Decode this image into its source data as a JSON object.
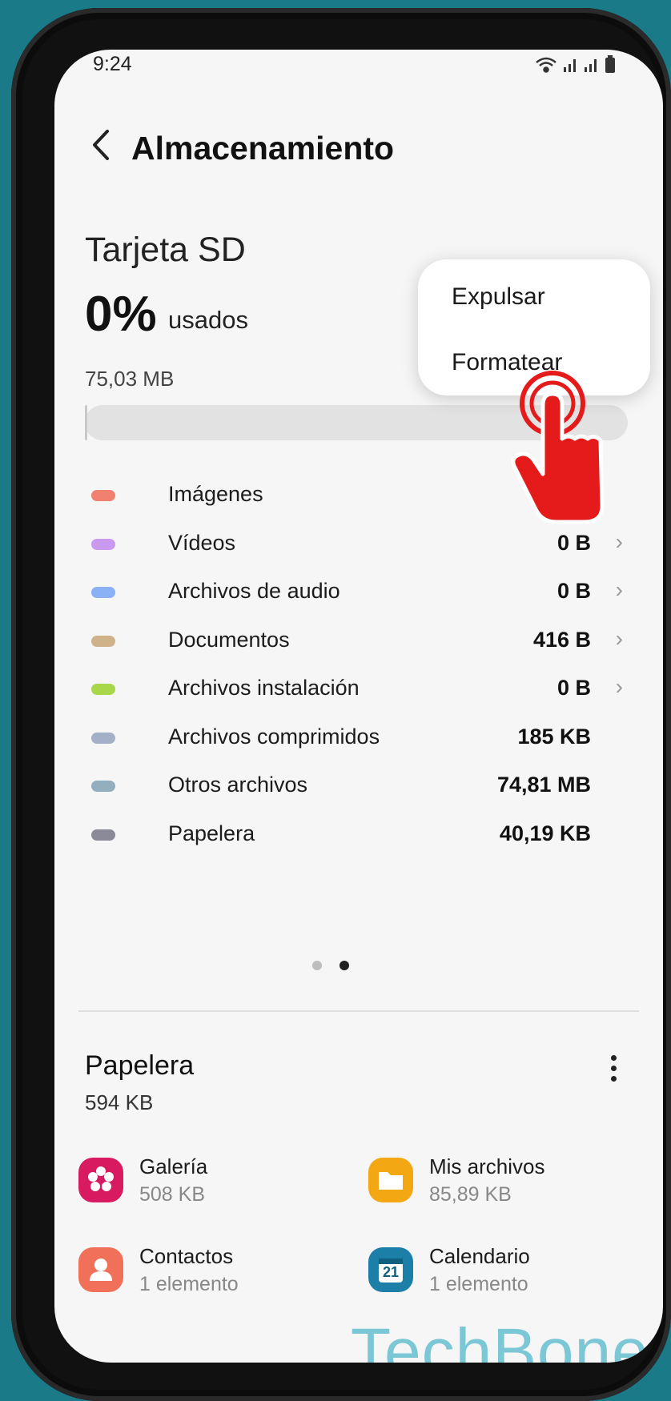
{
  "status_bar": {
    "time": "9:24",
    "icons": [
      "wifi-icon",
      "signal-icon",
      "signal-icon",
      "battery-icon"
    ]
  },
  "header": {
    "title": "Almacenamiento"
  },
  "storage": {
    "device": "Tarjeta SD",
    "percent": "0%",
    "percent_suffix": "usados",
    "total": "75,03 MB",
    "used_fraction": 0.0
  },
  "categories": [
    {
      "label": "Imágenes",
      "size": "",
      "color": "#f08070",
      "chevron": false
    },
    {
      "label": "Vídeos",
      "size": "0 B",
      "color": "#c99af0",
      "chevron": true
    },
    {
      "label": "Archivos de audio",
      "size": "0 B",
      "color": "#8ab0f5",
      "chevron": true
    },
    {
      "label": "Documentos",
      "size": "416 B",
      "color": "#d0b28a",
      "chevron": true
    },
    {
      "label": "Archivos instalación",
      "size": "0 B",
      "color": "#a8d84a",
      "chevron": true
    },
    {
      "label": "Archivos comprimidos",
      "size": "185 KB",
      "color": "#a4b0c8",
      "chevron": false
    },
    {
      "label": "Otros archivos",
      "size": "74,81 MB",
      "color": "#93afbf",
      "chevron": false
    },
    {
      "label": "Papelera",
      "size": "40,19 KB",
      "color": "#8a8a98",
      "chevron": false
    }
  ],
  "pager": {
    "total": 2,
    "active": 2
  },
  "trash": {
    "title": "Papelera",
    "size": "594 KB",
    "apps": [
      {
        "name": "Galería",
        "sub": "508 KB",
        "icon": "gallery-icon",
        "color": "#d81b60"
      },
      {
        "name": "Mis archivos",
        "sub": "85,89 KB",
        "icon": "folder-icon",
        "color": "#f3a712"
      },
      {
        "name": "Contactos",
        "sub": "1 elemento",
        "icon": "contacts-icon",
        "color": "#f0705a"
      },
      {
        "name": "Calendario",
        "sub": "1 elemento",
        "icon": "calendar-icon",
        "color": "#1c7fa8",
        "badge": "21"
      }
    ]
  },
  "menu": {
    "items": [
      "Expulsar",
      "Formatear"
    ]
  },
  "watermark": "TechBone"
}
